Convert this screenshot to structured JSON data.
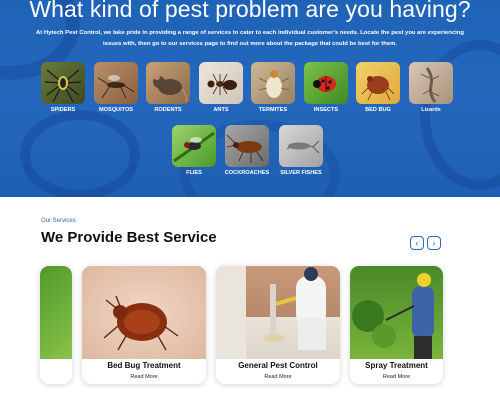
{
  "hero": {
    "title": "What kind of pest problem are you having?",
    "description": "At Hytech Pest Control, we take pride in providing a range of services to cater to each individual customer's needs. Locate the pest you are experiencing issues with, then go to our services page to find out more about the package that could be best for them.",
    "background_color": "#1f63b8",
    "pests": [
      {
        "label": "SPIDERS",
        "icon": "spider"
      },
      {
        "label": "MOSQUITOS",
        "icon": "mosquito"
      },
      {
        "label": "RODENTS",
        "icon": "rodent"
      },
      {
        "label": "ANTS",
        "icon": "ant"
      },
      {
        "label": "TERMITES",
        "icon": "termite"
      },
      {
        "label": "INSECTS",
        "icon": "ladybug"
      },
      {
        "label": "BED BUG",
        "icon": "bed-bug"
      },
      {
        "label": "Lizards",
        "icon": "lizard"
      },
      {
        "label": "FLIES",
        "icon": "fly"
      },
      {
        "label": "COCKROACHES",
        "icon": "cockroach"
      },
      {
        "label": "SILVER FISHES",
        "icon": "silverfish"
      }
    ]
  },
  "services": {
    "kicker": "Our Services",
    "title": "We Provide Best Service",
    "prev_icon": "chevron-left",
    "next_icon": "chevron-right",
    "accent_color": "#2a6ab8",
    "cards": [
      {
        "title": "Bed Bug Treatment",
        "link": "Read More"
      },
      {
        "title": "General Pest Control",
        "link": "Read More"
      },
      {
        "title": "Spray Treatment",
        "link": "Read More"
      }
    ]
  }
}
